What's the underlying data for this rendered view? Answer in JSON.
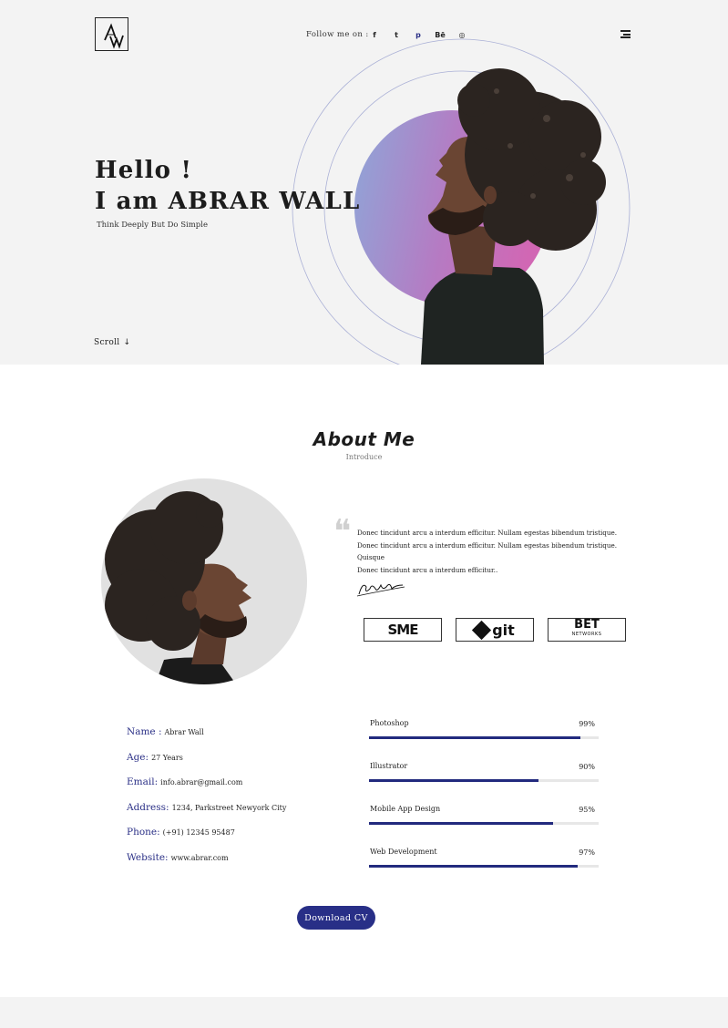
{
  "header": {
    "logo_text": "AW",
    "follow_label": "Follow me on :",
    "socials": [
      {
        "name": "facebook",
        "glyph": "f"
      },
      {
        "name": "twitter",
        "glyph": "t"
      },
      {
        "name": "pinterest",
        "glyph": "p"
      },
      {
        "name": "behance",
        "glyph": "Bē"
      },
      {
        "name": "dribbble",
        "glyph": "◎"
      }
    ]
  },
  "hero": {
    "greeting": "Hello !",
    "name_line": "I am ABRAR WALL",
    "tagline": "Think Deeply But Do Simple",
    "scroll_label": "Scroll",
    "scroll_arrow": "↓",
    "gradient_colors": [
      "#8ea6d8",
      "#b57bc3",
      "#d167b4"
    ]
  },
  "about": {
    "title": "About Me",
    "subtitle": "Introduce",
    "quote_mark": "❝",
    "quote_lines": [
      "Donec tincidunt arcu a interdum efficitur. Nullam egestas bibendum tristique.",
      "Donec tincidunt arcu a interdum efficitur. Nullam egestas bibendum tristique. Quisque",
      "Donec tincidunt arcu a interdum efficitur.."
    ],
    "brands": {
      "sme": "SME",
      "git": "git",
      "bet": "BET",
      "bet_sub": "NETWORKS"
    }
  },
  "info": [
    {
      "label": "Name :",
      "value": "Abrar Wall"
    },
    {
      "label": "Age:",
      "value": "27 Years"
    },
    {
      "label": "Email:",
      "value": "info.abrar@gmail.com"
    },
    {
      "label": "Address:",
      "value": "1234, Parkstreet Newyork City"
    },
    {
      "label": "Phone:",
      "value": "(+91) 12345 95487"
    },
    {
      "label": "Website:",
      "value": "www.abrar.com"
    }
  ],
  "skills": [
    {
      "name": "Photoshop",
      "percent_label": "99%",
      "level": 0.92
    },
    {
      "name": "Illustrator",
      "percent_label": "90%",
      "level": 0.74
    },
    {
      "name": "Mobile App Design",
      "percent_label": "95%",
      "level": 0.8
    },
    {
      "name": "Web Development",
      "percent_label": "97%",
      "level": 0.91
    }
  ],
  "cta": {
    "download_label": "Download CV"
  },
  "colors": {
    "accent": "#282f87",
    "hero_bg": "#f3f3f3"
  }
}
